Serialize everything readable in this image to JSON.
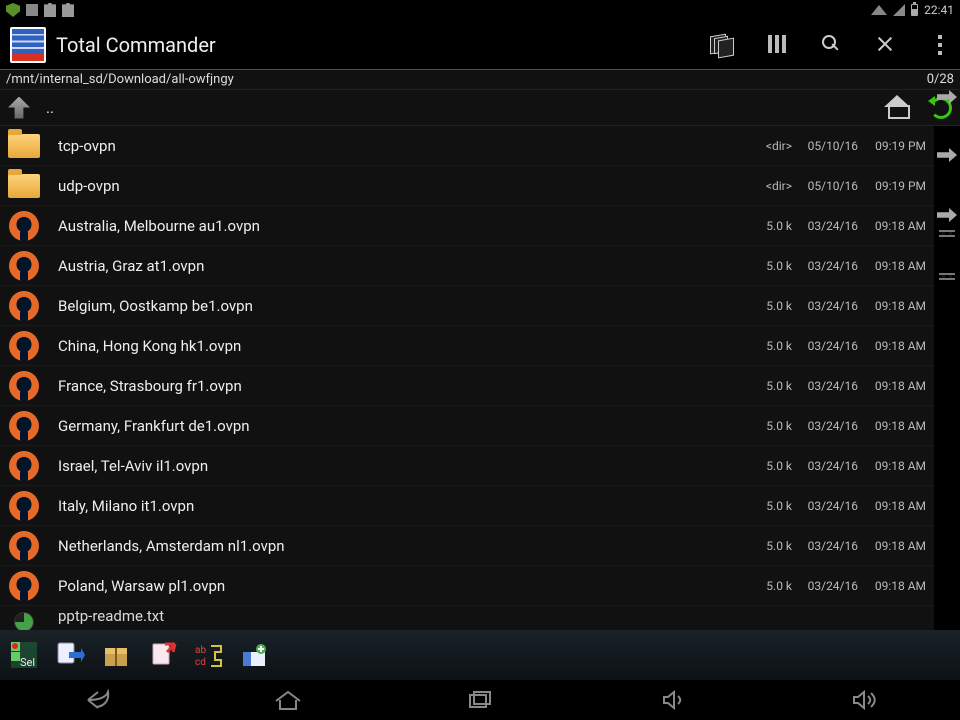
{
  "status": {
    "time": "22:41"
  },
  "app": {
    "title": "Total Commander"
  },
  "path": "/mnt/internal_sd/Download/all-owfjngy",
  "counter": "0/28",
  "nav": {
    "up_label": ".."
  },
  "files": [
    {
      "icon": "folder",
      "name": "tcp-ovpn",
      "size": "<dir>",
      "date": "05/10/16",
      "time": "09:19 PM"
    },
    {
      "icon": "folder",
      "name": "udp-ovpn",
      "size": "<dir>",
      "date": "05/10/16",
      "time": "09:19 PM"
    },
    {
      "icon": "ovpn",
      "name": "Australia, Melbourne au1.ovpn",
      "size": "5.0 k",
      "date": "03/24/16",
      "time": "09:18 AM"
    },
    {
      "icon": "ovpn",
      "name": "Austria, Graz at1.ovpn",
      "size": "5.0 k",
      "date": "03/24/16",
      "time": "09:18 AM"
    },
    {
      "icon": "ovpn",
      "name": "Belgium, Oostkamp be1.ovpn",
      "size": "5.0 k",
      "date": "03/24/16",
      "time": "09:18 AM"
    },
    {
      "icon": "ovpn",
      "name": "China, Hong Kong hk1.ovpn",
      "size": "5.0 k",
      "date": "03/24/16",
      "time": "09:18 AM"
    },
    {
      "icon": "ovpn",
      "name": "France, Strasbourg fr1.ovpn",
      "size": "5.0 k",
      "date": "03/24/16",
      "time": "09:18 AM"
    },
    {
      "icon": "ovpn",
      "name": "Germany, Frankfurt de1.ovpn",
      "size": "5.0 k",
      "date": "03/24/16",
      "time": "09:18 AM"
    },
    {
      "icon": "ovpn",
      "name": "Israel, Tel-Aviv il1.ovpn",
      "size": "5.0 k",
      "date": "03/24/16",
      "time": "09:18 AM"
    },
    {
      "icon": "ovpn",
      "name": "Italy, Milano it1.ovpn",
      "size": "5.0 k",
      "date": "03/24/16",
      "time": "09:18 AM"
    },
    {
      "icon": "ovpn",
      "name": "Netherlands, Amsterdam nl1.ovpn",
      "size": "5.0 k",
      "date": "03/24/16",
      "time": "09:18 AM"
    },
    {
      "icon": "ovpn",
      "name": "Poland, Warsaw pl1.ovpn",
      "size": "5.0 k",
      "date": "03/24/16",
      "time": "09:18 AM"
    },
    {
      "icon": "txt",
      "name": "pptp-readme.txt",
      "size": "",
      "date": "",
      "time": ""
    }
  ],
  "toolbar_label": {
    "sel": "Sel"
  }
}
